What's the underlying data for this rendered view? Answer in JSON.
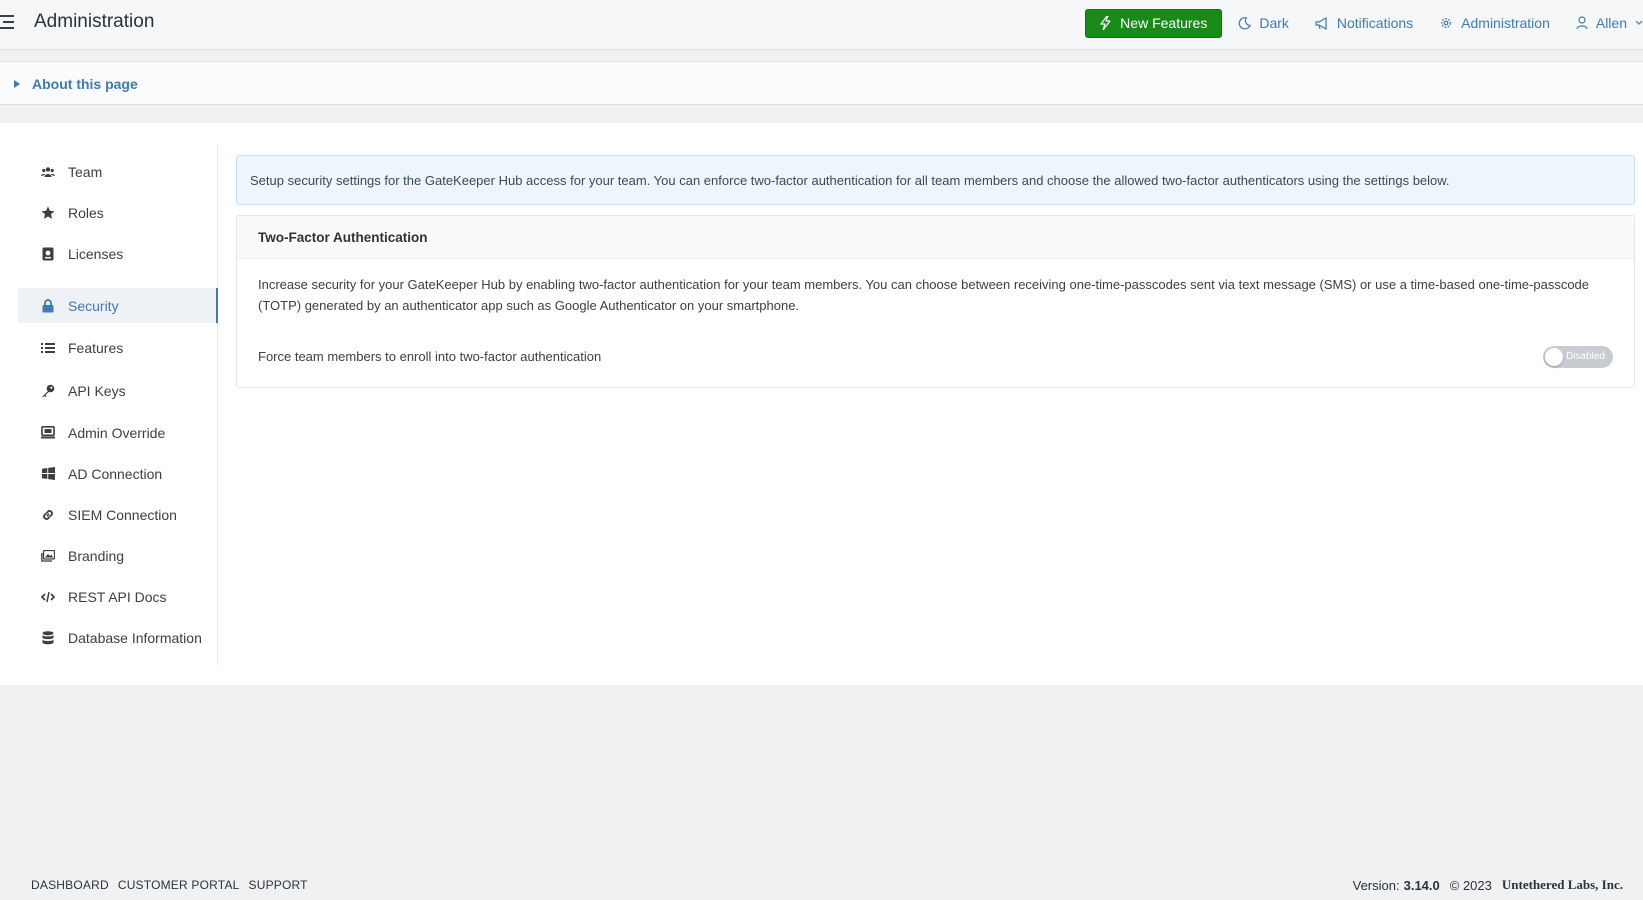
{
  "header": {
    "title": "Administration",
    "new_features_label": "New Features",
    "dark_label": "Dark",
    "notifications_label": "Notifications",
    "administration_label": "Administration",
    "user_label": "Allen"
  },
  "about": {
    "label": "About this page"
  },
  "sidebar": {
    "items": [
      {
        "label": "Team",
        "icon": "users-icon"
      },
      {
        "label": "Roles",
        "icon": "star-icon"
      },
      {
        "label": "Licenses",
        "icon": "license-icon"
      },
      {
        "label": "Security",
        "icon": "lock-icon",
        "active": true
      },
      {
        "label": "Features",
        "icon": "list-icon"
      },
      {
        "label": "API Keys",
        "icon": "key-icon"
      },
      {
        "label": "Admin Override",
        "icon": "monitor-icon"
      },
      {
        "label": "AD Connection",
        "icon": "windows-icon"
      },
      {
        "label": "SIEM Connection",
        "icon": "link-icon"
      },
      {
        "label": "Branding",
        "icon": "images-icon"
      },
      {
        "label": "REST API Docs",
        "icon": "code-icon"
      },
      {
        "label": "Database Information",
        "icon": "database-icon"
      }
    ]
  },
  "content": {
    "info_text": "Setup security settings for the GateKeeper Hub access for your team. You can enforce two-factor authentication for all team members and choose the allowed two-factor authenticators using the settings below.",
    "card": {
      "title": "Two-Factor Authentication",
      "description": "Increase security for your GateKeeper Hub by enabling two-factor authentication for your team members. You can choose between receiving one-time-passcodes sent via text message (SMS) or use a time-based one-time-passcode (TOTP) generated by an authenticator app such as Google Authenticator on your smartphone.",
      "setting_label": "Force team members to enroll into two-factor authentication",
      "toggle_label": "Disabled",
      "toggle_on": false
    }
  },
  "footer": {
    "links": [
      "DASHBOARD",
      "CUSTOMER PORTAL",
      "SUPPORT"
    ],
    "version_label": "Version:",
    "version_number": "3.14.0",
    "copyright": "© 2023",
    "company": "Untethered Labs, Inc."
  },
  "colors": {
    "accent": "#3f7ab2",
    "success": "#178a17",
    "info_bg": "#eef6fb",
    "toggle_off": "#c8ccd1"
  }
}
